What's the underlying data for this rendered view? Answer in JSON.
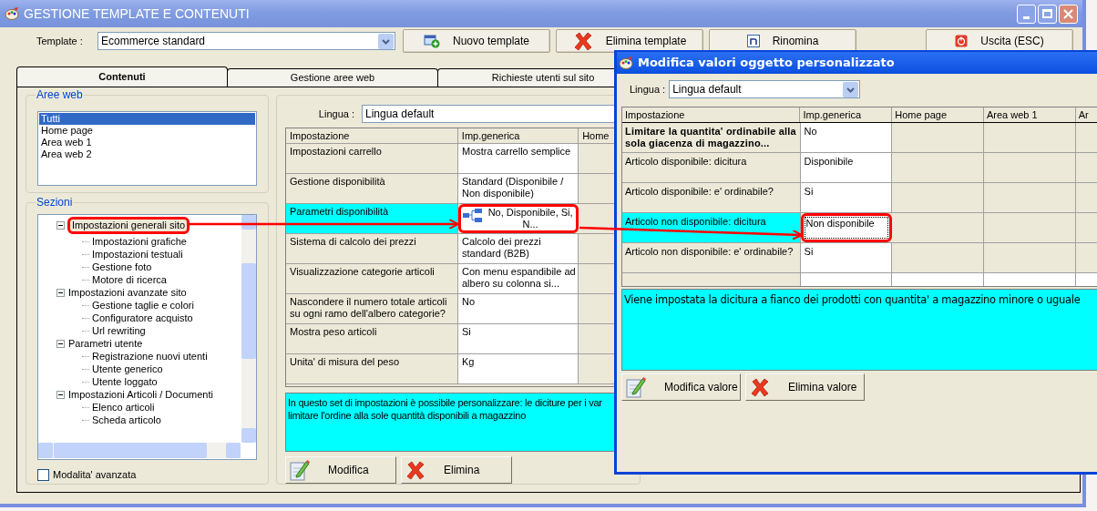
{
  "window": {
    "title": "GESTIONE TEMPLATE E CONTENUTI"
  },
  "toolbar": {
    "template_label": "Template :",
    "template_value": "Ecommerce standard",
    "buttons": [
      {
        "label": "Nuovo template",
        "kind": "new"
      },
      {
        "label": "Elimina template",
        "kind": "delete"
      },
      {
        "label": "Rinomina",
        "kind": "rename"
      },
      {
        "label": "Uscita (ESC)",
        "kind": "exit"
      }
    ]
  },
  "tabs": [
    {
      "label": "Contenuti",
      "selected": true
    },
    {
      "label": "Gestione aree web",
      "selected": false
    },
    {
      "label": "Richieste utenti sul sito",
      "selected": false
    }
  ],
  "aree_web": {
    "title": "Aree web",
    "items": [
      {
        "label": "Tutti",
        "selected": true
      },
      {
        "label": "Home page",
        "selected": false
      },
      {
        "label": "Area web 1",
        "selected": false
      },
      {
        "label": "Area web 2",
        "selected": false
      }
    ]
  },
  "sezioni": {
    "title": "Sezioni",
    "tree": [
      {
        "label": "Impostazioni generali sito",
        "selected": true,
        "expanded": true,
        "children": [
          {
            "label": "Impostazioni grafiche"
          },
          {
            "label": "Impostazioni testuali"
          },
          {
            "label": "Gestione foto"
          },
          {
            "label": "Motore di ricerca"
          }
        ]
      },
      {
        "label": "Impostazioni avanzate sito",
        "selected": false,
        "expanded": true,
        "children": [
          {
            "label": "Gestione taglie e colori"
          },
          {
            "label": "Configuratore acquisto"
          },
          {
            "label": "Url rewriting"
          }
        ]
      },
      {
        "label": "Parametri utente",
        "selected": false,
        "expanded": true,
        "children": [
          {
            "label": "Registrazione nuovi utenti"
          },
          {
            "label": "Utente generico"
          },
          {
            "label": "Utente loggato"
          }
        ]
      },
      {
        "label": "Impostazioni Articoli / Documenti",
        "selected": false,
        "expanded": true,
        "children": [
          {
            "label": "Elenco articoli"
          },
          {
            "label": "Scheda articolo"
          }
        ]
      }
    ]
  },
  "advanced_mode": {
    "label": "Modalita' avanzata",
    "checked": false
  },
  "settings": {
    "lingua_label": "Lingua :",
    "lingua_value": "Lingua default",
    "columns": [
      "Impostazione",
      "Imp.generica",
      "Home"
    ],
    "rows": [
      {
        "name": "Impostazioni carrello",
        "value": "Mostra carrello semplice",
        "kind": "text",
        "selected": false
      },
      {
        "name": "Gestione disponibilità",
        "value": "Standard (Disponibile / Non disponibile)",
        "kind": "text",
        "selected": false
      },
      {
        "name": "Parametri disponibilità",
        "value": "No, Disponibile, Si, N...",
        "kind": "group",
        "selected": true
      },
      {
        "name": "Sistema di calcolo dei prezzi",
        "value": "Calcolo dei prezzi standard (B2B)",
        "kind": "text",
        "selected": false
      },
      {
        "name": "Visualizzazione categorie articoli",
        "value": "Con menu espandibile ad albero su colonna si...",
        "kind": "text",
        "selected": false
      },
      {
        "name": "Nascondere il numero totale articoli su ogni ramo dell'albero categorie?",
        "value": "No",
        "kind": "text",
        "selected": false
      },
      {
        "name": "Mostra peso articoli",
        "value": "Si",
        "kind": "text",
        "selected": false
      },
      {
        "name": "Unita' di misura del peso",
        "value": "Kg",
        "kind": "text",
        "selected": false
      }
    ],
    "description": [
      "In questo set di impostazioni è possibile personalizzare: le diciture per i var",
      "limitare l'ordine alla sole quantità disponibili a magazzino"
    ],
    "buttons": [
      {
        "label": "Modifica",
        "kind": "edit"
      },
      {
        "label": "Elimina",
        "kind": "delete"
      }
    ]
  },
  "dialog": {
    "title": "Modifica valori oggetto personalizzato",
    "lingua_label": "Lingua :",
    "lingua_value": "Lingua default",
    "columns": [
      "Impostazione",
      "Imp.generica",
      "Home page",
      "Area web 1",
      "Ar"
    ],
    "rows": [
      {
        "name": "Limitare la quantita' ordinabile alla sola giacenza di magazzino...",
        "value": "No",
        "kind": "header",
        "selected": false
      },
      {
        "name": "Articolo disponibile: dicitura",
        "value": "Disponibile",
        "kind": "text",
        "selected": false
      },
      {
        "name": "Articolo disponibile: e' ordinabile?",
        "value": "Si",
        "kind": "text",
        "selected": false
      },
      {
        "name": "Articolo non disponibile: dicitura",
        "value": "Non disponibile",
        "kind": "text",
        "selected": true
      },
      {
        "name": "Articolo non disponibile: e' ordinabile?",
        "value": "Si",
        "kind": "text",
        "selected": false
      }
    ],
    "description": "Viene impostata la dicitura a fianco dei prodotti con quantita' a magazzino minore o uguale",
    "buttons": [
      {
        "label": "Modifica valore",
        "kind": "edit"
      },
      {
        "label": "Elimina valore",
        "kind": "delete"
      }
    ]
  }
}
